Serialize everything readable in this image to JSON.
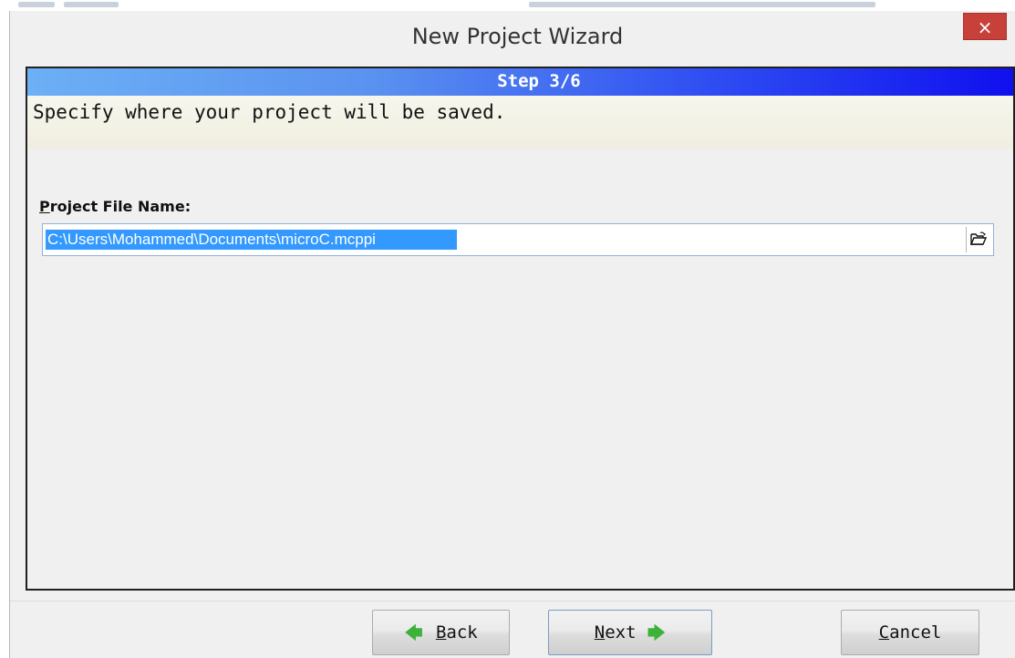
{
  "window": {
    "title": "New Project Wizard",
    "close_label": "×"
  },
  "step": {
    "label": "Step 3/6"
  },
  "instruction": "Specify where your project will be saved.",
  "project_file": {
    "label_first": "P",
    "label_rest": "roject File Name:",
    "value": "C:\\Users\\Mohammed\\Documents\\microC.mcppi",
    "browse_icon": "open-folder-icon"
  },
  "buttons": {
    "back": {
      "arrow": "🡄",
      "mnemonic": "B",
      "rest": "ack"
    },
    "next": {
      "mnemonic": "N",
      "rest": "ext",
      "arrow": "🡆"
    },
    "cancel": {
      "mnemonic": "C",
      "rest": "ancel"
    }
  },
  "colors": {
    "step_band_start": "#6cb0f5",
    "step_band_end": "#1010ee",
    "selection": "#3399ff",
    "close_button": "#c7413a",
    "arrow_green": "#3db23a"
  }
}
